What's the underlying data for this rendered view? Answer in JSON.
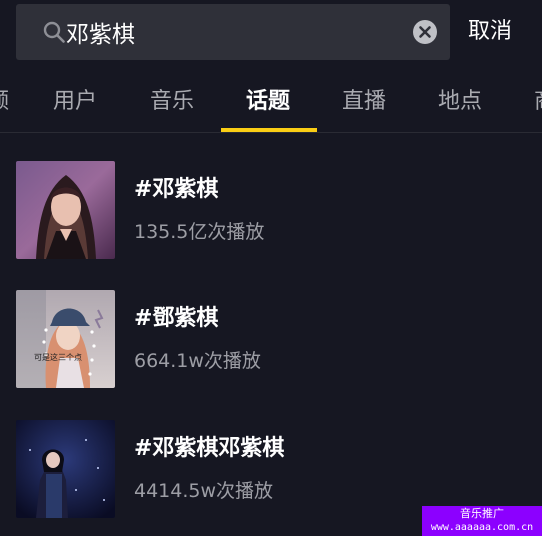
{
  "search": {
    "query": "邓紫棋",
    "cancel_label": "取消"
  },
  "tabs": [
    {
      "label": "频"
    },
    {
      "label": "用户"
    },
    {
      "label": "音乐"
    },
    {
      "label": "话题",
      "active": true
    },
    {
      "label": "直播"
    },
    {
      "label": "地点"
    },
    {
      "label": "商"
    }
  ],
  "results": [
    {
      "title": "#邓紫棋",
      "views": "135.5亿次播放"
    },
    {
      "title": "#鄧紫棋",
      "views": "664.1w次播放",
      "thumb_caption": "可是这三个点"
    },
    {
      "title": "#邓紫棋邓紫棋",
      "views": "4414.5w次播放"
    }
  ],
  "watermark": {
    "line1": "音乐推广",
    "line2": "www.aaaaaa.com.cn"
  },
  "colors": {
    "background": "#161722",
    "search_bg": "#2f3039",
    "tab_indicator": "#face15",
    "muted_text": "#9d9ea5",
    "watermark_bg": "#8c00ff"
  }
}
